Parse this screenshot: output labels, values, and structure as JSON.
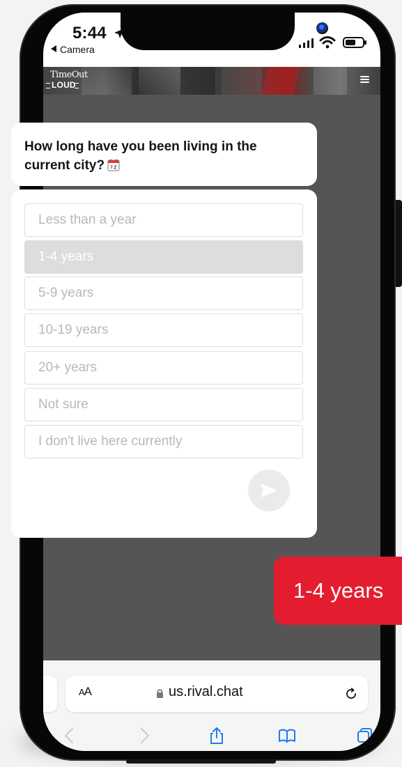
{
  "status": {
    "time": "5:44",
    "back_label": "Camera"
  },
  "site": {
    "logo_top": "TimeOut",
    "logo_bottom": "LOUD"
  },
  "survey": {
    "question": "How long have you been living in the current city?",
    "options": [
      "Less than a year",
      "1-4 years",
      "5-9 years",
      "10-19 years",
      "20+ years",
      "Not sure",
      "I don't live here currently"
    ],
    "selected_option": "1-4 years"
  },
  "chat": {
    "reply": "1-4 years"
  },
  "browser": {
    "text_size_label_large": "A",
    "text_size_label_small": "A",
    "url": "us.rival.chat"
  },
  "icons": {
    "location": "location-arrow-icon",
    "signal": "cellular-signal-icon",
    "wifi": "wifi-icon",
    "battery": "battery-icon",
    "calendar": "calendar-icon",
    "send": "send-icon",
    "lock": "lock-icon",
    "reload": "reload-icon",
    "back": "back-icon",
    "forward": "forward-icon",
    "share": "share-icon",
    "bookmarks": "book-icon",
    "tabs": "tabs-icon",
    "menu": "hamburger-menu-icon"
  },
  "colors": {
    "accent_red": "#e31d2f",
    "selected_option_bg": "#dddddd",
    "page_overlay": "#555555"
  }
}
